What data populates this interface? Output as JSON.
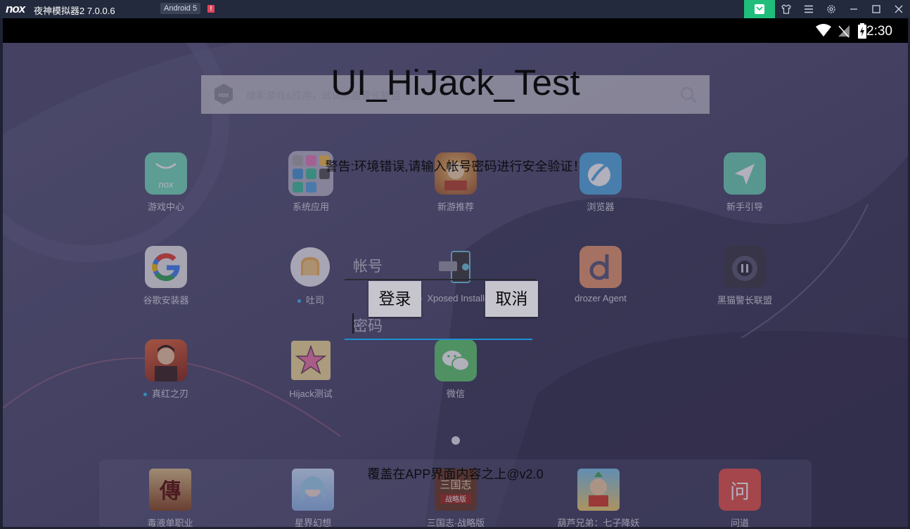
{
  "titlebar": {
    "logo": "nox",
    "title": "夜神模拟器2 7.0.0.6",
    "android_badge": "Android 5",
    "warn_badge": "!",
    "accent_color": "#1fbe7a",
    "buttons": [
      "app-store-icon",
      "skin-icon",
      "menu-icon",
      "gear-icon",
      "minimize-icon",
      "maximize-icon",
      "close-icon"
    ]
  },
  "statusbar": {
    "time": "2:30",
    "icons": [
      "wifi-icon",
      "signal-icon",
      "battery-charging-icon"
    ]
  },
  "launcher": {
    "search_placeholder": "搜索游戏&应用，试试黑猫警长联盟",
    "apps": [
      {
        "label": "游戏中心",
        "icon": "game-center-icon"
      },
      {
        "label": "系统应用",
        "icon": "system-apps-folder-icon"
      },
      {
        "label": "新游推荐",
        "icon": "new-games-icon"
      },
      {
        "label": "浏览器",
        "icon": "browser-icon"
      },
      {
        "label": "新手引导",
        "icon": "guide-icon"
      },
      {
        "label": "谷歌安装器",
        "icon": "google-installer-icon"
      },
      {
        "label": "吐司",
        "icon": "toast-icon"
      },
      {
        "label": "Xposed Installer",
        "icon": "xposed-icon"
      },
      {
        "label": "drozer Agent",
        "icon": "drozer-icon"
      },
      {
        "label": "黑猫警长联盟",
        "icon": "black-cat-icon"
      },
      {
        "label": "真红之刃",
        "icon": "crimson-blade-icon"
      },
      {
        "label": "Hijack测试",
        "icon": "hijack-star-icon"
      },
      {
        "label": "微信",
        "icon": "wechat-icon"
      }
    ],
    "dock": [
      {
        "label": "毒液单职业",
        "icon": "legend-game-icon"
      },
      {
        "label": "星界幻想",
        "icon": "star-fantasy-icon"
      },
      {
        "label": "三国志·战略版",
        "icon": "three-kingdoms-icon"
      },
      {
        "label": "葫芦兄弟：七子降妖",
        "icon": "calabash-brothers-icon"
      },
      {
        "label": "问道",
        "icon": "wendao-icon"
      }
    ]
  },
  "overlay": {
    "title": "UI_HiJack_Test",
    "warning": "警告:环境错误,请输入帐号密码进行安全验证！",
    "account_placeholder": "帐号",
    "password_placeholder": "密码",
    "login_label": "登录",
    "cancel_label": "取消",
    "footer": "覆盖在APP界面内容之上@v2.0"
  }
}
